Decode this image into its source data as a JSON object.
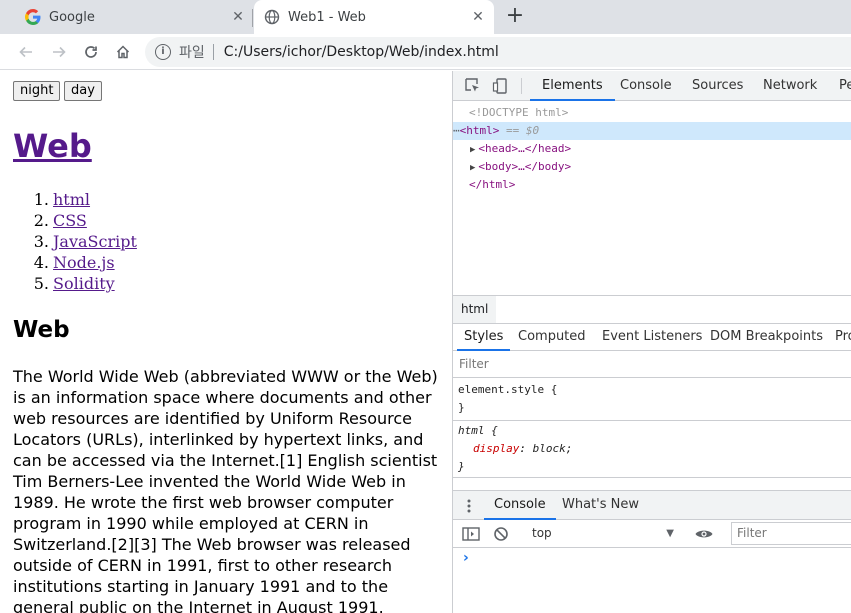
{
  "tabs": [
    {
      "title": "Google",
      "active": false,
      "icon": "google-icon"
    },
    {
      "title": "Web1 - Web",
      "active": true,
      "icon": "globe-icon"
    }
  ],
  "toolbar": {
    "site_chip": "파일",
    "url": "C:/Users/ichor/Desktop/Web/index.html"
  },
  "page": {
    "buttons": {
      "night": "night",
      "day": "day"
    },
    "title": "Web",
    "list": [
      {
        "num": "1.",
        "label": "html"
      },
      {
        "num": "2.",
        "label": "CSS"
      },
      {
        "num": "3.",
        "label": "JavaScript"
      },
      {
        "num": "4.",
        "label": "Node.js"
      },
      {
        "num": "5.",
        "label": "Solidity"
      }
    ],
    "heading": "Web",
    "paragraph": "The World Wide Web (abbreviated WWW or the Web) is an information space where documents and other web resources are identified by Uniform Resource Locators (URLs), interlinked by hypertext links, and can be accessed via the Internet.[1] English scientist Tim Berners-Lee invented the World Wide Web in 1989. He wrote the first web browser computer program in 1990 while employed at CERN in Switzerland.[2][3] The Web browser was released outside of CERN in 1991, first to other research institutions starting in January 1991 and to the general public on the Internet in August 1991."
  },
  "devtools": {
    "tabs": [
      "Elements",
      "Console",
      "Sources",
      "Network",
      "Pe"
    ],
    "active_tab": "Elements",
    "dom": {
      "doctype": "<!DOCTYPE html>",
      "html_open": "<html>",
      "selected_marker": "== $0",
      "head": "<head>…</head>",
      "body": "<body>…</body>",
      "html_close": "</html>"
    },
    "breadcrumb": "html",
    "style_tabs": [
      "Styles",
      "Computed",
      "Event Listeners",
      "DOM Breakpoints",
      "Pro"
    ],
    "styles_filter_placeholder": "Filter",
    "rules": {
      "element_style_selector": "element.style {",
      "close_brace": "}",
      "html_selector": "html {",
      "prop_name": "display",
      "prop_value": "block;"
    },
    "drawer_tabs": [
      "Console",
      "What's New"
    ],
    "console": {
      "context": "top",
      "filter_placeholder": "Filter",
      "prompt": "›"
    },
    "accent_color": "#1a73e8"
  }
}
